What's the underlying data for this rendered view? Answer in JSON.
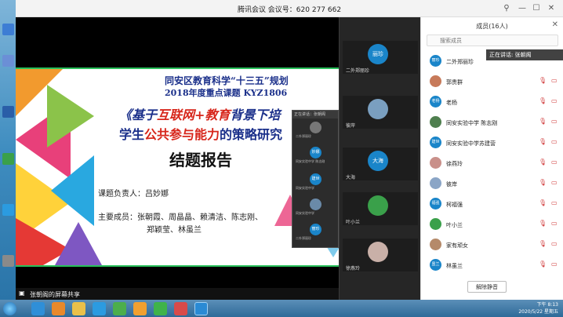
{
  "window": {
    "title": "腾讯会议 会议号：620 277 662"
  },
  "slide": {
    "line1": "同安区教育科学“十三五”规划",
    "line2": "2018年度重点课题 KYZ1806",
    "line3_a": "《基于",
    "line3_b": "互联网+教育",
    "line3_c": "背景下培",
    "line4_a": "学生",
    "line4_b": "公共参与能力",
    "line4_c": "的策略研究",
    "line5": "结题报告",
    "line6": "课题负责人：吕妙娜",
    "line7": "主要成员：张朝霞、周晶晶、赖清洁、陈志刚、",
    "line8": "郑颖莹、林虽兰"
  },
  "share_label": "张朝阁的屏幕共享",
  "float_panel": {
    "header": "正在讲话：张朝阁",
    "items": [
      {
        "avatar": "",
        "name": "二外郑丽珍"
      },
      {
        "avatar": "妙娜",
        "name": "同安实验中学 陈志刚"
      },
      {
        "avatar": "建世",
        "name": "同安实验中学"
      },
      {
        "avatar": "",
        "name": "同安实验中学"
      },
      {
        "avatar": "丽珍",
        "name": "二外郑丽珍"
      }
    ]
  },
  "video_tiles": [
    {
      "avatar": "丽珍",
      "name": "二外郑丽珍",
      "color": "#1a85c9"
    },
    {
      "avatar": "",
      "name": "彼岸",
      "color": "#7a9fc0"
    },
    {
      "avatar": "大海",
      "name": "大海",
      "color": "#1a85c9"
    },
    {
      "avatar": "",
      "name": "叶小兰",
      "color": "#3aa04a"
    },
    {
      "avatar": "",
      "name": "徐燕玲",
      "color": "#c9b0a8"
    }
  ],
  "members": {
    "title": "成员(16人)",
    "search_placeholder": "搜索成员",
    "speaking": "正在讲话: 张朝阁",
    "unmute_all": "解除静音",
    "list": [
      {
        "avatar": "丽珍",
        "name": "二外郑丽珍",
        "color": "#1a85c9"
      },
      {
        "avatar": "",
        "name": "郭贵群",
        "color": "#c77a5a"
      },
      {
        "avatar": "老杨",
        "name": "老杨",
        "color": "#1a85c9"
      },
      {
        "avatar": "",
        "name": "同安实验中学 陈志刚",
        "color": "#4f7f4f"
      },
      {
        "avatar": "建世",
        "name": "同安实验中学苏建营",
        "color": "#1a85c9"
      },
      {
        "avatar": "",
        "name": "徐燕玲",
        "color": "#c9908a"
      },
      {
        "avatar": "",
        "name": "彼岸",
        "color": "#8aa5c6"
      },
      {
        "avatar": "福强",
        "name": "柯福强",
        "color": "#1a85c9"
      },
      {
        "avatar": "",
        "name": "叶小兰",
        "color": "#3aa04a"
      },
      {
        "avatar": "",
        "name": "家有顽女",
        "color": "#b58a6a"
      },
      {
        "avatar": "虽兰",
        "name": "林虽兰",
        "color": "#1a85c9"
      }
    ]
  },
  "taskbar": {
    "time": "下午 8:13",
    "date": "2020/5/22 星期五"
  }
}
